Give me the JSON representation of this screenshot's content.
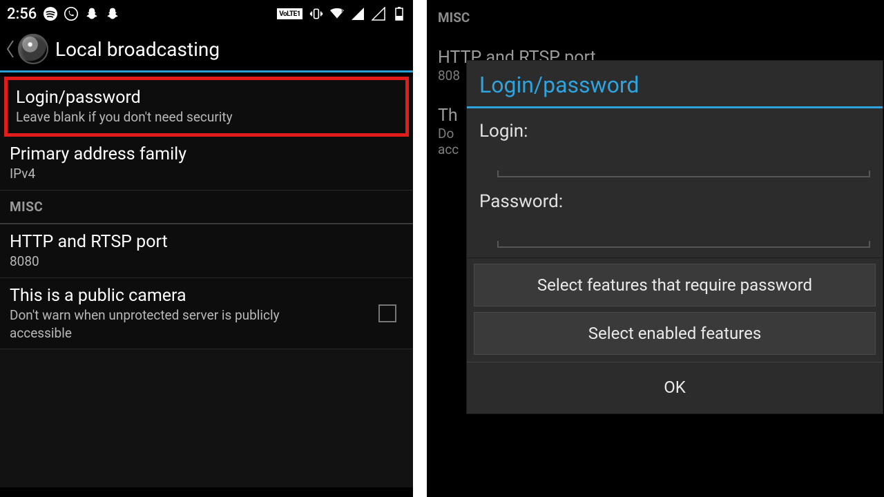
{
  "left": {
    "status": {
      "clock": "2:56",
      "volte": "VoLTE1"
    },
    "title": "Local broadcasting",
    "rows": {
      "login": {
        "title": "Login/password",
        "sub": "Leave blank if you don't need security"
      },
      "family": {
        "title": "Primary address family",
        "sub": "IPv4"
      },
      "misc_header": "MISC",
      "port": {
        "title": "HTTP and RTSP port",
        "sub": "8080"
      },
      "public": {
        "title": "This is a public camera",
        "sub": "Don't warn when unprotected server is publicly accessible"
      }
    }
  },
  "right": {
    "bg": {
      "misc": "MISC",
      "port_title": "HTTP and RTSP port",
      "port_sub": "808",
      "th": "Th",
      "do": "Do",
      "acc": "acc"
    },
    "dialog": {
      "title": "Login/password",
      "login_label": "Login:",
      "password_label": "Password:",
      "btn1": "Select features that require password",
      "btn2": "Select enabled features",
      "ok": "OK"
    }
  }
}
